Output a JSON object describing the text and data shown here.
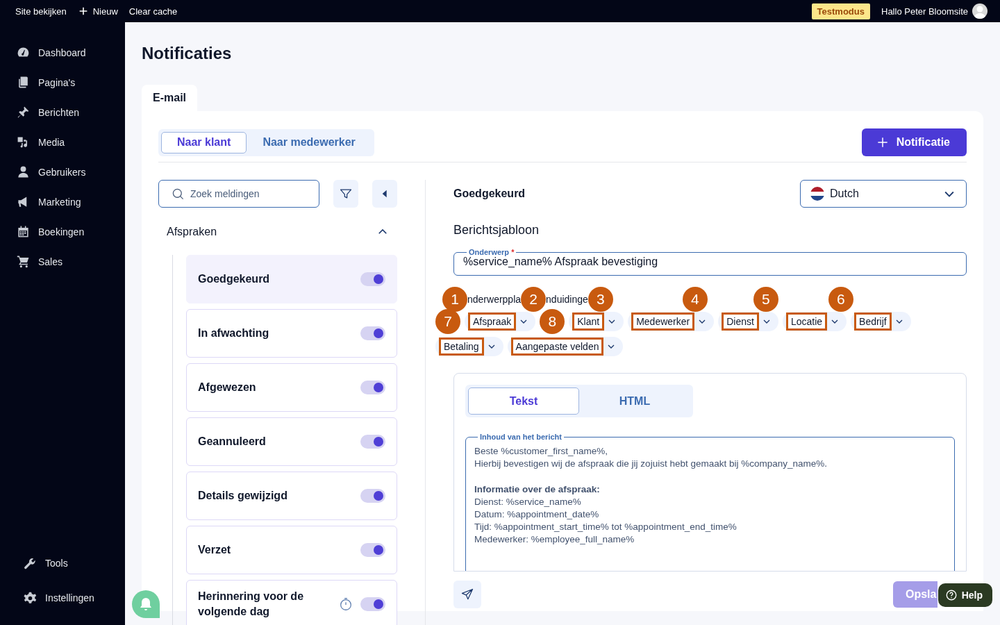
{
  "topbar": {
    "links": [
      {
        "label": "Site bekijken",
        "kind": "text"
      },
      {
        "label": "Nieuw",
        "kind": "new"
      },
      {
        "label": "Clear cache",
        "kind": "text"
      }
    ],
    "badge": "Testmodus",
    "greeting": "Hallo Peter Bloomsite"
  },
  "sidebar": {
    "items": [
      {
        "label": "Dashboard"
      },
      {
        "label": "Pagina's"
      },
      {
        "label": "Berichten"
      },
      {
        "label": "Media"
      },
      {
        "label": "Gebruikers"
      },
      {
        "label": "Marketing"
      },
      {
        "label": "Boekingen"
      },
      {
        "label": "Sales"
      }
    ],
    "bottom_items": [
      {
        "label": "Tools"
      },
      {
        "label": "Instellingen"
      }
    ]
  },
  "page": {
    "title": "Notificaties",
    "tabs": [
      {
        "label": "E-mail",
        "selected": true
      }
    ]
  },
  "audience_tabs": [
    {
      "label": "Naar klant",
      "selected": true
    },
    {
      "label": "Naar medewerker",
      "selected": false
    }
  ],
  "add_button": "Notificatie",
  "search": {
    "placeholder": "Zoek meldingen"
  },
  "group": {
    "label": "Afspraken",
    "expanded": true,
    "items": [
      {
        "label": "Goedgekeurd",
        "selected": true,
        "on": true,
        "timer": false
      },
      {
        "label": "In afwachting",
        "selected": false,
        "on": true,
        "timer": false
      },
      {
        "label": "Afgewezen",
        "selected": false,
        "on": true,
        "timer": false
      },
      {
        "label": "Geannuleerd",
        "selected": false,
        "on": true,
        "timer": false
      },
      {
        "label": "Details gewijzigd",
        "selected": false,
        "on": true,
        "timer": false
      },
      {
        "label": "Verzet",
        "selected": false,
        "on": true,
        "timer": false
      },
      {
        "label": "Herinnering voor de volgende dag",
        "selected": false,
        "on": true,
        "timer": true
      }
    ]
  },
  "detail": {
    "title": "Goedgekeurd",
    "language": "Dutch",
    "section": "Berichtsjabloon",
    "subject": {
      "label": "Onderwerp",
      "required_mark": "*",
      "value": "%service_name% Afspraak bevestiging"
    },
    "placeholders_label_parts": [
      "nderwerppla",
      "nduidinge"
    ],
    "placeholder_chips": [
      {
        "label": "Afspraak",
        "highlighted": true
      },
      {
        "label": "Klant",
        "highlighted": true
      },
      {
        "label": "Medewerker",
        "highlighted": true
      },
      {
        "label": "Dienst",
        "highlighted": true
      },
      {
        "label": "Locatie",
        "highlighted": true
      },
      {
        "label": "Bedrijf",
        "highlighted": true
      },
      {
        "label": "Betaling",
        "highlighted": true
      },
      {
        "label": "Aangepaste velden",
        "highlighted": true
      }
    ],
    "markers": [
      "1",
      "2",
      "3",
      "4",
      "5",
      "6",
      "7",
      "8"
    ],
    "format_tabs": [
      {
        "label": "Tekst",
        "selected": true
      },
      {
        "label": "HTML",
        "selected": false
      }
    ],
    "body": {
      "label": "Inhoud van het bericht",
      "value": "Beste %customer_first_name%,\nHierbij bevestigen wij de afspraak die jij zojuist hebt gemaakt bij %company_name%.\n\n**Informatie over de afspraak:**\nDienst: %service_name%\nDatum: %appointment_date%\nTijd: %appointment_start_time% tot %appointment_end_time%\nMedewerker: %employee_full_name%"
    },
    "save_button": "Opsla",
    "help_button": "Help"
  }
}
